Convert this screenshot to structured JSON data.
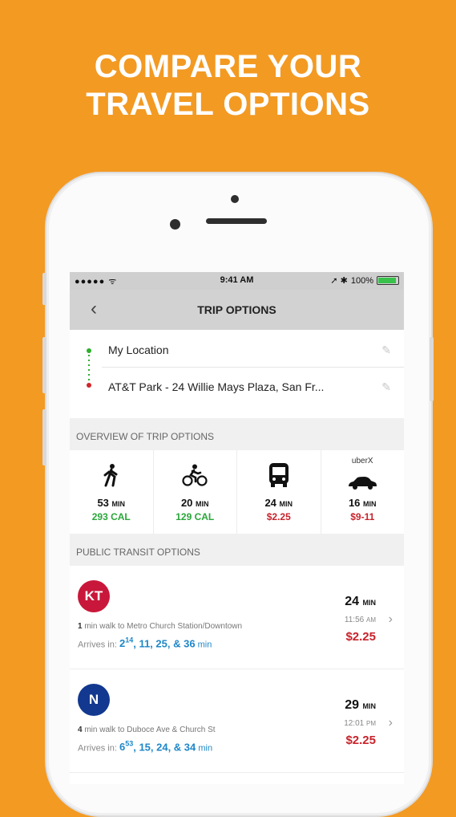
{
  "headline": {
    "line1": "COMPARE YOUR",
    "line2": "TRAVEL OPTIONS"
  },
  "status": {
    "carrier": "●●●●● ᯤ",
    "time": "9:41 AM",
    "icons": "➚ ✱",
    "battery_pct": "100%"
  },
  "nav": {
    "back_label": "‹",
    "title": "TRIP OPTIONS"
  },
  "route": {
    "from": "My Location",
    "to": "AT&T Park - 24 Willie Mays Plaza, San Fr..."
  },
  "overview": {
    "header": "OVERVIEW OF TRIP OPTIONS",
    "modes": [
      {
        "icon": "walking-icon",
        "minutes": "53",
        "unit": "MIN",
        "sub": "293 CAL",
        "sub_color": "#2aa63a"
      },
      {
        "icon": "bicycle-icon",
        "minutes": "20",
        "unit": "MIN",
        "sub": "129 CAL",
        "sub_color": "#2aa63a"
      },
      {
        "icon": "bus-icon",
        "minutes": "24",
        "unit": "MIN",
        "sub": "$2.25",
        "sub_color": "#c8232b"
      },
      {
        "icon": "car-icon",
        "label": "uberX",
        "minutes": "16",
        "unit": "MIN",
        "sub": "$9-11",
        "sub_color": "#c8232b"
      }
    ]
  },
  "transit": {
    "header": "PUBLIC TRANSIT OPTIONS",
    "trips": [
      {
        "line": "KT",
        "line_color": "#c8173a",
        "walk_min": "1",
        "walk_text": " min walk to Metro Church Station/Downtown",
        "arrives_label": "Arrives in: ",
        "first_base": "2",
        "first_sup": "14",
        "rest": ", 11, 25, & 36",
        "unit": " min",
        "duration": "24",
        "duration_unit": "MIN",
        "clock": "11:56",
        "clock_ampm": "AM",
        "price": "$2.25"
      },
      {
        "line": "N",
        "line_color": "#12388f",
        "walk_min": "4",
        "walk_text": " min walk to Duboce Ave & Church St",
        "arrives_label": "Arrives in: ",
        "first_base": "6",
        "first_sup": "53",
        "rest": ", 15, 24, & 34",
        "unit": " min",
        "duration": "29",
        "duration_unit": "MIN",
        "clock": "12:01",
        "clock_ampm": "PM",
        "price": "$2.25"
      }
    ]
  }
}
